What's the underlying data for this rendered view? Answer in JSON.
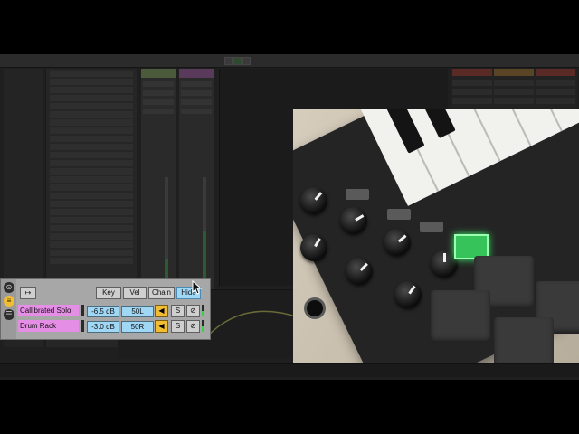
{
  "panel": {
    "toggle_icon": "arrow-toggle-icon",
    "buttons": [
      {
        "label": "Key",
        "active": false
      },
      {
        "label": "Vel",
        "active": false
      },
      {
        "label": "Chain",
        "active": false
      },
      {
        "label": "Hide",
        "active": true
      }
    ],
    "tracks": [
      {
        "name": "Callibrated Solo",
        "volume": "-6.5 dB",
        "pan": "50L",
        "solo": "S"
      },
      {
        "name": "Drum Rack",
        "volume": "-3.0 dB",
        "pan": "50R",
        "solo": "S"
      }
    ]
  },
  "colors": {
    "track": "#e58ee5",
    "value_field": "#9fd7f5",
    "activator": "#f1bd32",
    "pad_glow": "#3df26b"
  }
}
